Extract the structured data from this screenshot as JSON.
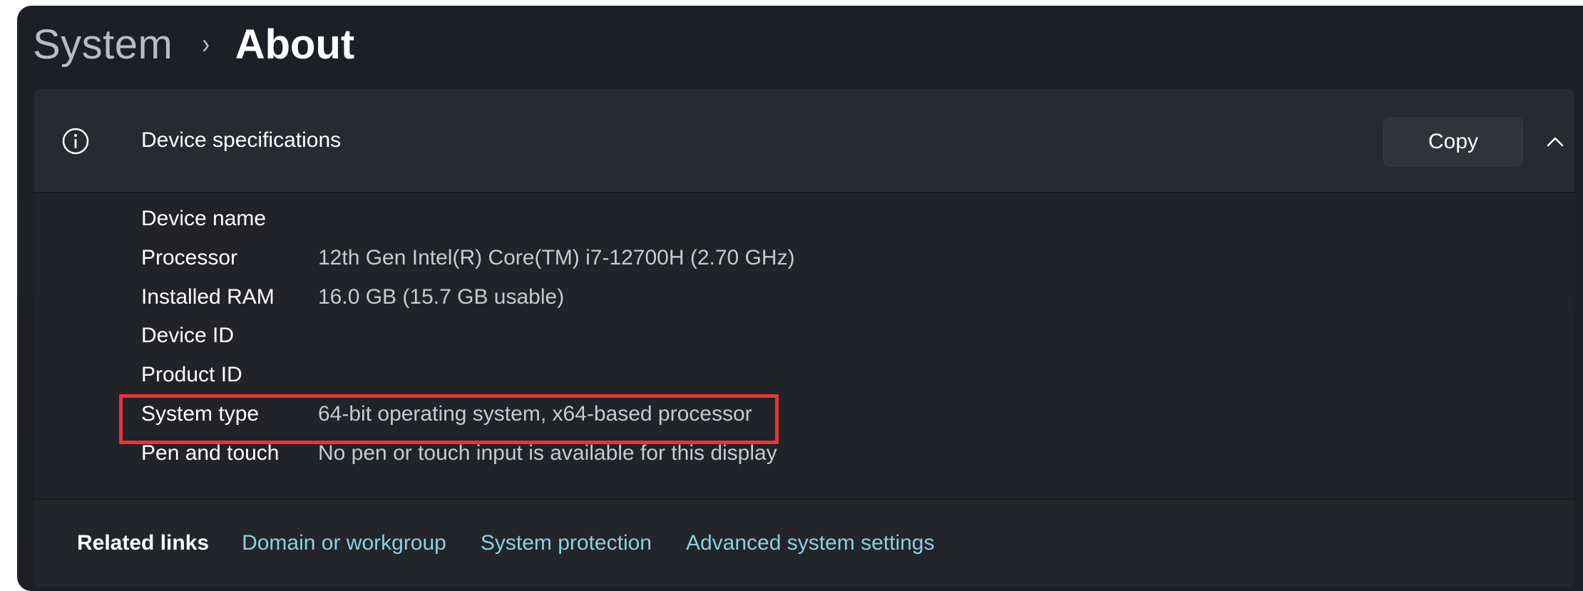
{
  "breadcrumb": {
    "parent": "System",
    "separator": "›",
    "current": "About"
  },
  "device_specs": {
    "icon": "info-icon",
    "title": "Device specifications",
    "copy_label": "Copy",
    "toggle_icon": "chevron-up-icon",
    "rows": [
      {
        "label": "Device name",
        "value": ""
      },
      {
        "label": "Processor",
        "value": "12th Gen Intel(R) Core(TM) i7-12700H (2.70 GHz)"
      },
      {
        "label": "Installed RAM",
        "value": "16.0 GB (15.7 GB usable)"
      },
      {
        "label": "Device ID",
        "value": ""
      },
      {
        "label": "Product ID",
        "value": ""
      },
      {
        "label": "System type",
        "value": "64-bit operating system, x64-based processor"
      },
      {
        "label": "Pen and touch",
        "value": "No pen or touch input is available for this display"
      }
    ]
  },
  "related_links": {
    "label": "Related links",
    "links": [
      "Domain or workgroup",
      "System protection",
      "Advanced system settings"
    ]
  },
  "colors": {
    "highlight": "#e53636",
    "link": "#8ccfe8",
    "background": "#1e2127"
  }
}
